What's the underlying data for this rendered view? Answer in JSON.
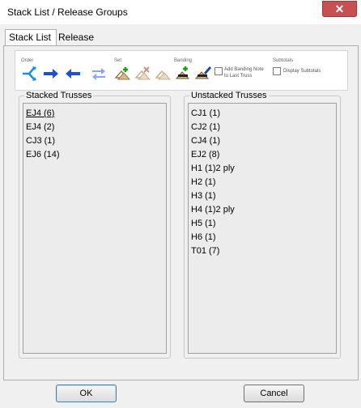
{
  "window": {
    "title": "Stack List / Release Groups",
    "close_glyph": "✕"
  },
  "tabs": [
    {
      "label": "Stack List"
    },
    {
      "label": "Release Groups"
    }
  ],
  "toolbar": {
    "order_label": "Order",
    "set_label": "Set",
    "banding_label": "Banding",
    "banding_note_label_1": "Add Banding Note",
    "banding_note_label_2": "to Last Truss",
    "subtotals_label": "Subtotals",
    "display_subtotals_label": "Display Subtotals",
    "banding_note_checked": false,
    "display_subtotals_checked": false,
    "icons": [
      "split-arrows-icon",
      "arrow-right-icon",
      "arrow-left-icon",
      "swap-arrows-icon",
      "set-add-icon",
      "set-remove-icon",
      "set-clear-icon",
      "banding-add-icon",
      "banding-edit-icon"
    ]
  },
  "stacked": {
    "title": "Stacked Trusses",
    "items": [
      "EJ4 (6)",
      "EJ4 (2)",
      "CJ3 (1)",
      "EJ6 (14)"
    ]
  },
  "unstacked": {
    "title": "Unstacked Trusses",
    "items": [
      "CJ1 (1)",
      "CJ2 (1)",
      "CJ4 (1)",
      "EJ2 (8)",
      "H1 (1)2 ply",
      "H2 (1)",
      "H3 (1)",
      "H4 (1)2 ply",
      "H5 (1)",
      "H6 (1)",
      "T01 (7)"
    ]
  },
  "buttons": {
    "ok": "OK",
    "cancel": "Cancel"
  },
  "colors": {
    "arrow_blue": "#1a4fe0",
    "close_red": "#c75050",
    "swap_light": "#8aa4ff"
  }
}
